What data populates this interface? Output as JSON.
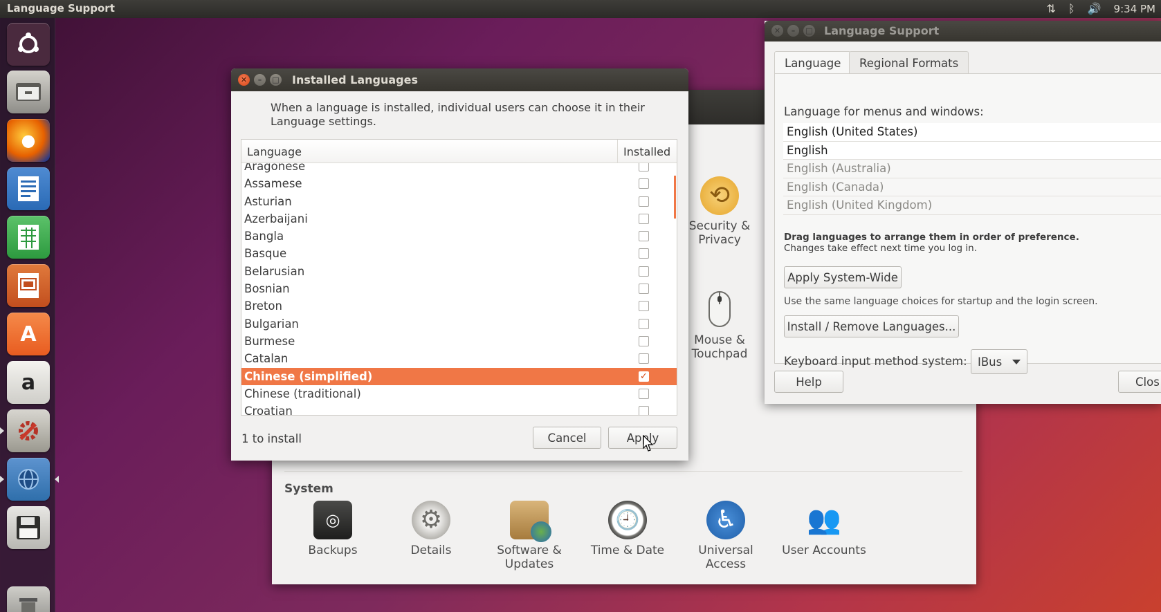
{
  "topbar": {
    "title": "Language Support",
    "time": "9:34 PM",
    "icons": [
      "network-updown-icon",
      "bluetooth-icon",
      "volume-icon"
    ]
  },
  "launcher": {
    "items": [
      {
        "name": "ubuntu-dash-icon",
        "color": "#e0493f"
      },
      {
        "name": "files-icon",
        "color": "#8e8d88"
      },
      {
        "name": "firefox-icon",
        "color": "#e66000"
      },
      {
        "name": "libreoffice-writer-icon",
        "color": "#2a6ab5"
      },
      {
        "name": "libreoffice-calc-icon",
        "color": "#2d9a3f"
      },
      {
        "name": "libreoffice-impress-icon",
        "color": "#c24e1e"
      },
      {
        "name": "software-center-icon",
        "color": "#e85c20"
      },
      {
        "name": "amazon-icon",
        "color": "#d7d6d1"
      },
      {
        "name": "system-settings-icon",
        "color": "#b53226"
      },
      {
        "name": "language-support-icon",
        "color": "#2f6fab"
      },
      {
        "name": "save-disk-icon",
        "color": "#3a3a38"
      },
      {
        "name": "trash-icon",
        "color": "#8a8985"
      }
    ]
  },
  "settings": {
    "system_heading": "System",
    "hardware_icons": [
      {
        "label": "Security & Privacy",
        "icon": "security-privacy-icon"
      },
      {
        "label": "Mouse & Touchpad",
        "icon": "mouse-touchpad-icon"
      }
    ],
    "system_icons": [
      {
        "label": "Backups",
        "icon": "backups-icon"
      },
      {
        "label": "Details",
        "icon": "details-icon"
      },
      {
        "label": "Software & Updates",
        "icon": "software-updates-icon"
      },
      {
        "label": "Time & Date",
        "icon": "time-date-icon"
      },
      {
        "label": "Universal Access",
        "icon": "universal-access-icon"
      },
      {
        "label": "User Accounts",
        "icon": "user-accounts-icon"
      }
    ]
  },
  "installed_dialog": {
    "title": "Installed Languages",
    "description": "When a language is installed, individual users can choose it in their Language settings.",
    "columns": {
      "language": "Language",
      "installed": "Installed"
    },
    "rows": [
      {
        "name": "Aragonese",
        "installed": false,
        "selected": false
      },
      {
        "name": "Assamese",
        "installed": false,
        "selected": false
      },
      {
        "name": "Asturian",
        "installed": false,
        "selected": false
      },
      {
        "name": "Azerbaijani",
        "installed": false,
        "selected": false
      },
      {
        "name": "Bangla",
        "installed": false,
        "selected": false
      },
      {
        "name": "Basque",
        "installed": false,
        "selected": false
      },
      {
        "name": "Belarusian",
        "installed": false,
        "selected": false
      },
      {
        "name": "Bosnian",
        "installed": false,
        "selected": false
      },
      {
        "name": "Breton",
        "installed": false,
        "selected": false
      },
      {
        "name": "Bulgarian",
        "installed": false,
        "selected": false
      },
      {
        "name": "Burmese",
        "installed": false,
        "selected": false
      },
      {
        "name": "Catalan",
        "installed": false,
        "selected": false
      },
      {
        "name": "Chinese (simplified)",
        "installed": true,
        "selected": true
      },
      {
        "name": "Chinese (traditional)",
        "installed": false,
        "selected": false
      },
      {
        "name": "Croatian",
        "installed": false,
        "selected": false
      }
    ],
    "status": "1 to install",
    "cancel_label": "Cancel",
    "apply_label": "Apply",
    "accent": "#f07746"
  },
  "language_support": {
    "title": "Language Support",
    "tabs": [
      {
        "label": "Language",
        "active": true
      },
      {
        "label": "Regional Formats",
        "active": false
      }
    ],
    "menus_label": "Language for menus and windows:",
    "languages": [
      {
        "name": "English (United States)",
        "style": "strong"
      },
      {
        "name": "English",
        "style": "strong"
      },
      {
        "name": "English (Australia)",
        "style": "dim"
      },
      {
        "name": "English (Canada)",
        "style": "dim"
      },
      {
        "name": "English (United Kingdom)",
        "style": "dim"
      }
    ],
    "drag_note_bold": "Drag languages to arrange them in order of preference.",
    "drag_note": "Changes take effect next time you log in.",
    "apply_system_wide_label": "Apply System-Wide",
    "system_wide_note": "Use the same language choices for startup and the login screen.",
    "install_remove_label": "Install / Remove Languages...",
    "keyboard_label": "Keyboard input method system:",
    "keyboard_value": "IBus",
    "help_label": "Help",
    "close_label": "Clos"
  }
}
